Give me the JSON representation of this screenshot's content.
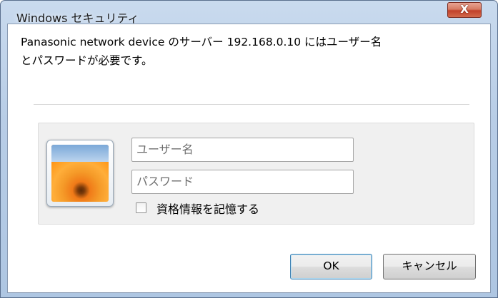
{
  "window": {
    "title": "Windows セキュリティ",
    "close_label": "X"
  },
  "message": {
    "line1": "Panasonic network device のサーバー 192.168.0.10 にはユーザー名",
    "line2": "とパスワードが必要です。"
  },
  "credentials": {
    "username_placeholder": "ユーザー名",
    "password_placeholder": "パスワード",
    "remember_label": "資格情報を記憶する",
    "remember_checked": false
  },
  "buttons": {
    "ok_label": "OK",
    "cancel_label": "キャンセル"
  },
  "icons": {
    "close": "close-icon",
    "avatar": "user-avatar-flower-icon",
    "checkbox": "checkbox-unchecked-icon"
  }
}
